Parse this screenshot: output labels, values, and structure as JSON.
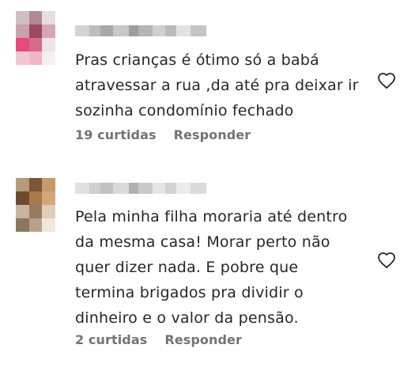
{
  "comments": [
    {
      "text": "Pras crianças é ótimo só a babá\natravessar a rua ,da até pra deixar ir\nsozinha condomínio fechado",
      "likes": "19 curtidas",
      "reply_label": "Responder",
      "avatar_colors": [
        "#cdbfc2",
        "#b08a92",
        "#e8dcdf",
        "#c9a2ab",
        "#9c4a5e",
        "#d6a4b2",
        "#e34b7a",
        "#d86b8a",
        "#efe3e7",
        "#f3c6d3",
        "#f1b7c7",
        "#f7eef1"
      ],
      "username_blur_colors": [
        "#d3d3d3",
        "#bdbdbd",
        "#a9a9a9",
        "#c8c8c8",
        "#9e9e9e",
        "#b5b5b5",
        "#d0d0d0",
        "#bcbcbc",
        "#e2e2e2",
        "#c4c4c4"
      ]
    },
    {
      "text": "Pela minha filha moraria até dentro\nda mesma casa! Morar perto não\nquer dizer nada. E pobre que\ntermina brigados pra dividir o\ndinheiro e o valor da pensão.",
      "likes": "2 curtidas",
      "reply_label": "Responder",
      "avatar_colors": [
        "#b59a7c",
        "#7c5636",
        "#c59a6c",
        "#6e4a30",
        "#a8794b",
        "#d3a777",
        "#c7b4a1",
        "#9a7a5e",
        "#e0cdb9",
        "#8d7661",
        "#b8a08a",
        "#f0e6dc"
      ],
      "username_blur_colors": [
        "#e0e0e0",
        "#cfcfcf",
        "#c2c2c2",
        "#d9d9d9",
        "#b0b0b0",
        "#cacaca",
        "#e5e5e5",
        "#d2d2d2",
        "#ececec",
        "#dadada"
      ]
    }
  ],
  "colors": {
    "text": "#262626",
    "secondary": "#737373",
    "icon_stroke": "#262626"
  }
}
